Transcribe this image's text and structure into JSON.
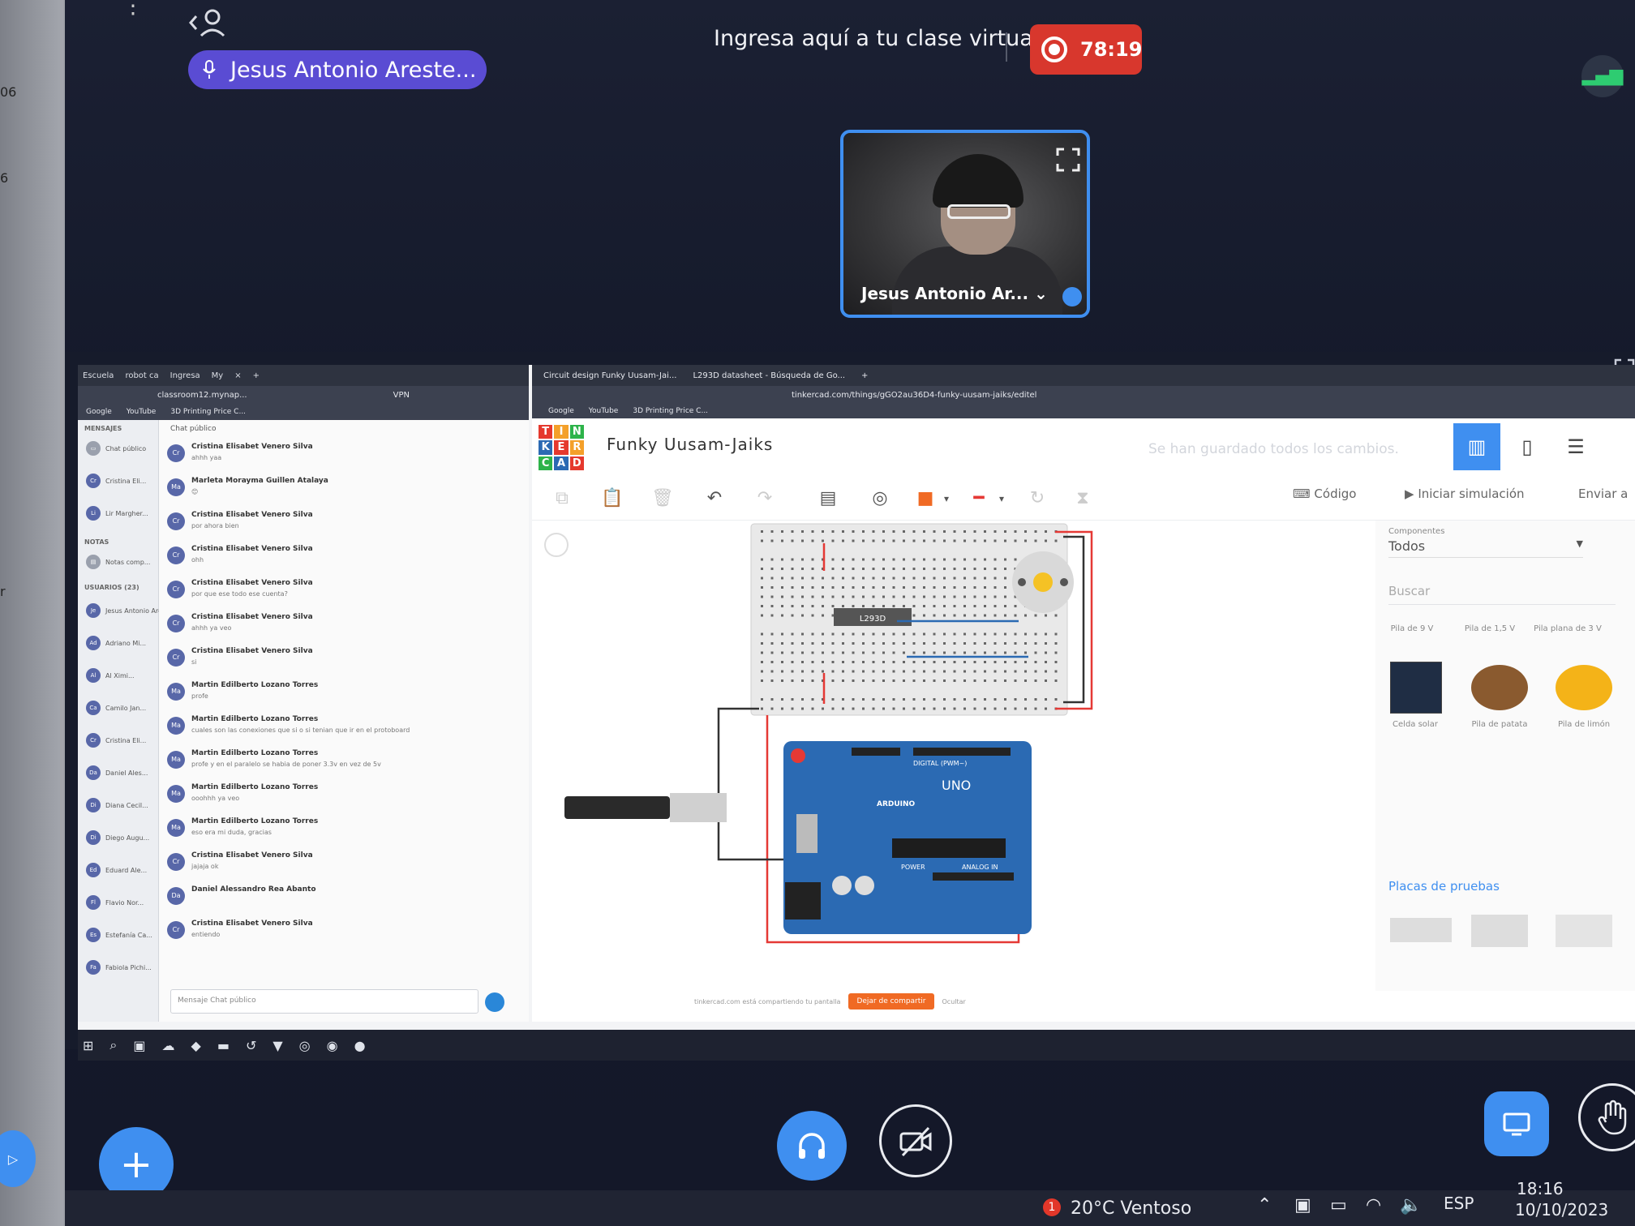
{
  "left_strip": {
    "numbers": [
      "06",
      "6",
      "r"
    ]
  },
  "meeting": {
    "title": "Ingresa aquí a tu clase virtual",
    "presenter_name": "Jesus Antonio Areste...",
    "recording_time": "78:19",
    "camera_tile_name": "Jesus Antonio Ar... ⌄"
  },
  "chat_window": {
    "tabs": [
      "Escuela",
      "robot ca",
      "Ingresa",
      "My",
      "×",
      "+"
    ],
    "address": "classroom12.mynap...",
    "vpn": "VPN",
    "bookmarks": [
      "Google",
      "YouTube",
      "3D Printing Price C..."
    ],
    "side": {
      "mensajes_label": "MENSAJES",
      "chat_publico": "Chat público",
      "contacts": [
        "Cristina Eli...",
        "Lir Margher..."
      ],
      "notas_label": "NOTAS",
      "notas_item": "Notas comp...",
      "usuarios_label": "USUARIOS (23)",
      "users": [
        {
          "initials": "Je",
          "name": "Jesus Antonio Areste..."
        },
        {
          "initials": "Ad",
          "name": "Adriano Mi..."
        },
        {
          "initials": "Al",
          "name": "Al Ximi..."
        },
        {
          "initials": "Ca",
          "name": "Camilo Jan..."
        },
        {
          "initials": "Cr",
          "name": "Cristina Eli..."
        },
        {
          "initials": "Da",
          "name": "Daniel Ales..."
        },
        {
          "initials": "Di",
          "name": "Diana Cecil..."
        },
        {
          "initials": "Di",
          "name": "Diego Augu..."
        },
        {
          "initials": "Ed",
          "name": "Eduard Ale..."
        },
        {
          "initials": "Fl",
          "name": "Flavio Nor..."
        },
        {
          "initials": "Es",
          "name": "Estefanía Ca..."
        },
        {
          "initials": "Fa",
          "name": "Fabiola Pichi..."
        }
      ]
    },
    "chat_header": "Chat público",
    "messages": [
      {
        "initials": "Cr",
        "name": "Cristina Elisabet Venero Silva",
        "text": "ahhh yaa"
      },
      {
        "initials": "Ma",
        "name": "Marleta Morayma Guillen Atalaya",
        "text": "😊"
      },
      {
        "initials": "Cr",
        "name": "Cristina Elisabet Venero Silva",
        "text": "por ahora bien"
      },
      {
        "initials": "Cr",
        "name": "Cristina Elisabet Venero Silva",
        "text": "ohh"
      },
      {
        "initials": "Cr",
        "name": "Cristina Elisabet Venero Silva",
        "text": "por que ese todo ese cuenta?"
      },
      {
        "initials": "Cr",
        "name": "Cristina Elisabet Venero Silva",
        "text": "ahhh ya veo"
      },
      {
        "initials": "Cr",
        "name": "Cristina Elisabet Venero Silva",
        "text": "si"
      },
      {
        "initials": "Ma",
        "name": "Martin Edilberto Lozano Torres",
        "text": "profe"
      },
      {
        "initials": "Ma",
        "name": "Martin Edilberto Lozano Torres",
        "text": "cuales son las conexiones que si o si tenian que ir en el protoboard"
      },
      {
        "initials": "Ma",
        "name": "Martin Edilberto Lozano Torres",
        "text": "profe y en el paralelo se habia de poner 3.3v en vez de 5v"
      },
      {
        "initials": "Ma",
        "name": "Martin Edilberto Lozano Torres",
        "text": "ooohhh ya veo"
      },
      {
        "initials": "Ma",
        "name": "Martin Edilberto Lozano Torres",
        "text": "eso era mi duda, gracias"
      },
      {
        "initials": "Cr",
        "name": "Cristina Elisabet Venero Silva",
        "text": "jajaja ok"
      },
      {
        "initials": "Da",
        "name": "Daniel Alessandro Rea Abanto",
        "text": ""
      },
      {
        "initials": "Cr",
        "name": "Cristina Elisabet Venero Silva",
        "text": "entiendo"
      }
    ],
    "input_placeholder": "Mensaje Chat público"
  },
  "tinkercad_window": {
    "tabs": [
      "Circuit design Funky Uusam-Jai...",
      "L293D datasheet - Búsqueda de Go...",
      "+"
    ],
    "address": "tinkercad.com/things/gGO2au36D4-funky-uusam-jaiks/editel",
    "bookmarks": [
      "Google",
      "YouTube",
      "3D Printing Price C..."
    ],
    "logo_letters": [
      "T",
      "I",
      "N",
      "K",
      "E",
      "R",
      "C",
      "A",
      "D"
    ],
    "project_name": "Funky Uusam-Jaiks",
    "saved_status": "Se han guardado todos los cambios.",
    "code_label": "Código",
    "simulate_label": "Iniciar simulación",
    "send_label": "Enviar a",
    "chip_label": "L293D",
    "arduino_labels": {
      "digital": "DIGITAL (PWM~)",
      "uno": "UNO",
      "arduino": "ARDUINO",
      "power": "POWER",
      "analog": "ANALOG IN"
    },
    "panel": {
      "componentes_label": "Componentes",
      "componentes_value": "Todos",
      "search_placeholder": "Buscar",
      "top_items": [
        "Pila de 9 V",
        "Pila de 1,5 V",
        "Pila plana de 3 V"
      ],
      "items": [
        "Celda solar",
        "Pila de patata",
        "Pila de limón"
      ],
      "section_title": "Placas de pruebas"
    },
    "share_bar_text": "tinkercad.com está compartiendo tu pantalla",
    "stop_share_label": "Dejar de compartir",
    "hide_label": "Ocultar"
  },
  "host_taskbar": {
    "weather": "20°C  Ventoso",
    "weather_badge": "1",
    "language": "ESP",
    "time": "18:16",
    "date": "10/10/2023"
  },
  "colors": {
    "accent": "#3f8ff0",
    "record": "#d8372d",
    "presenter": "#5a4cd3",
    "arduino": "#2b6ab3"
  }
}
